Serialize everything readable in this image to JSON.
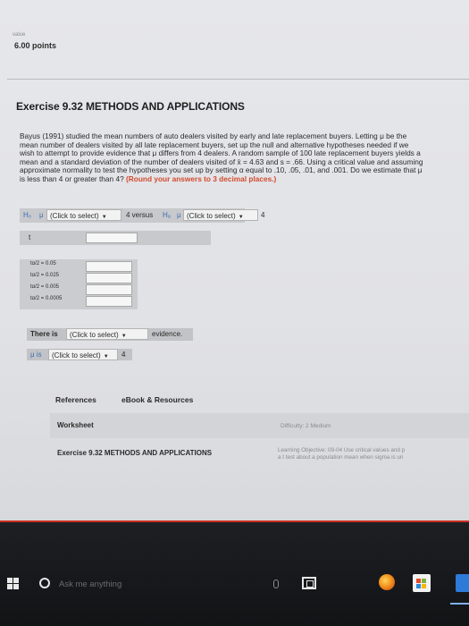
{
  "header": {
    "value_label": "value",
    "points": "6.00 points"
  },
  "exercise": {
    "title": "Exercise 9.32 METHODS AND APPLICATIONS",
    "problem_text": "Bayus (1991) studied the mean numbers of auto dealers visited by early and late replacement buyers. Letting μ be the mean number of dealers visited by all late replacement buyers, set up the null and alternative hypotheses needed if we wish to attempt to provide evidence that μ differs from 4 dealers. A random sample of 100 late replacement buyers yields a mean and a standard deviation of the number of dealers visited of x̄ = 4.63 and s = .66. Using a critical value and assuming approximate normality to test the hypotheses you set up by setting α equal to .10, .05, .01, and .001. Do we estimate that μ is less than 4 or greater than 4?",
    "hint": "(Round your answers to 3 decimal places.)"
  },
  "hypotheses": {
    "h0_label": "H₀",
    "ha_label": "Hₐ",
    "mu_symbol": "μ",
    "select_placeholder": "(Click to select)",
    "versus_text": "4 versus",
    "value_4": "4"
  },
  "t_row": {
    "label": "t"
  },
  "critical_values": {
    "items": [
      {
        "label": "tα/2 = 0.05"
      },
      {
        "label": "tα/2 = 0.025"
      },
      {
        "label": "tα/2 = 0.005"
      },
      {
        "label": "tα/2 = 0.0005"
      }
    ]
  },
  "conclusion": {
    "there_is": "There is",
    "select_placeholder": "(Click to select)",
    "evidence": "evidence.",
    "mu_is": "μ is",
    "value_4": "4"
  },
  "resources": {
    "references": "References",
    "ebook": "eBook & Resources"
  },
  "worksheet": {
    "label": "Worksheet",
    "difficulty": "Difficulty: 2 Medium",
    "exercise_ref": "Exercise 9.32 METHODS AND APPLICATIONS",
    "learning_objective_1": "Learning Objective: 09-04 Use critical values and p",
    "learning_objective_2": "a t test about a population mean when sigma is un"
  },
  "taskbar": {
    "search_placeholder": "Ask me anything"
  },
  "colors": {
    "hint_red": "#d24b2e",
    "taskbar_bg": "#16171a",
    "accent_red_line": "#c83024"
  }
}
